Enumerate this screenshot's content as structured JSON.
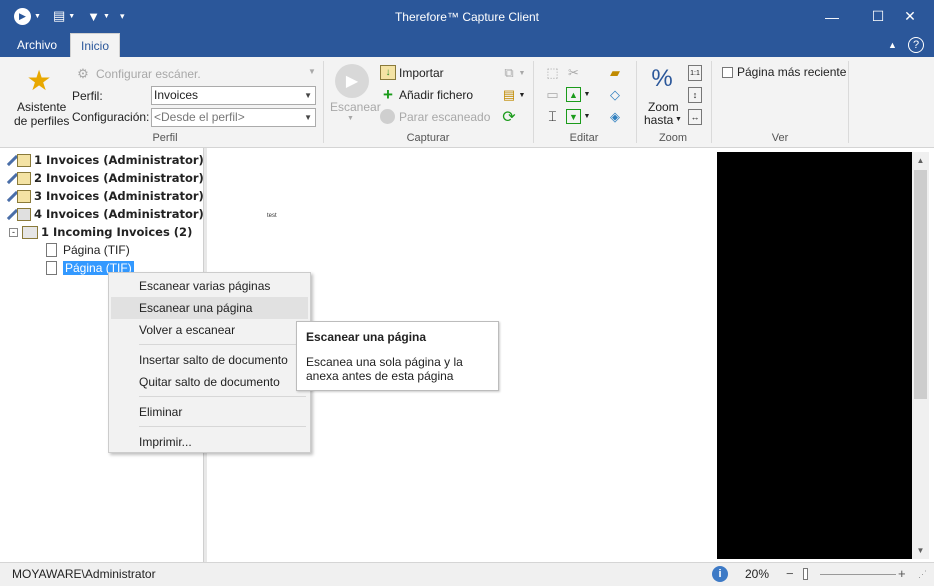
{
  "window": {
    "title": "Therefore™ Capture Client",
    "minimize": "—",
    "maximize": "☐",
    "close": "✕"
  },
  "ribbon": {
    "tabs": [
      "Archivo",
      "Inicio"
    ],
    "help": "?",
    "profile_group": {
      "wizard_label_1": "Asistente",
      "wizard_label_2": "de perfiles",
      "configure_scanner": "Configurar escáner.",
      "profile_label": "Perfil:",
      "profile_value": "Invoices",
      "config_label": "Configuración:",
      "config_value": "<Desde el perfil>",
      "group_label": "Perfil"
    },
    "capture_group": {
      "scan": "Escanear",
      "import": "Importar",
      "add_file": "Añadir fichero",
      "stop_scan": "Parar escaneado",
      "group_label": "Capturar"
    },
    "edit_group": {
      "group_label": "Editar"
    },
    "zoom_group": {
      "zoom_to_1": "Zoom",
      "zoom_to_2": "hasta",
      "group_label": "Zoom"
    },
    "view_group": {
      "recent_page": "Página más reciente",
      "group_label": "Ver"
    }
  },
  "tree": {
    "items": [
      {
        "label": "1 Invoices (Administrator)"
      },
      {
        "label": "2 Invoices (Administrator)"
      },
      {
        "label": "3 Invoices (Administrator)"
      },
      {
        "label": "4 Invoices (Administrator)"
      },
      {
        "label": "1 Incoming Invoices (2)"
      },
      {
        "label": "Página (TIF)"
      },
      {
        "label": "Página (TIF)"
      }
    ]
  },
  "preview": {
    "mini_text": "test"
  },
  "context_menu": {
    "items": [
      "Escanear varias páginas",
      "Escanear una página",
      "Volver a escanear",
      "Insertar salto de documento",
      "Quitar salto de documento",
      "Eliminar",
      "Imprimir..."
    ]
  },
  "tooltip": {
    "title": "Escanear una página",
    "description": "Escanea una sola página y la anexa antes de esta página"
  },
  "status": {
    "user": "MOYAWARE\\Administrator",
    "zoom": "20%",
    "zoom_minus": "−",
    "zoom_plus": "+"
  }
}
